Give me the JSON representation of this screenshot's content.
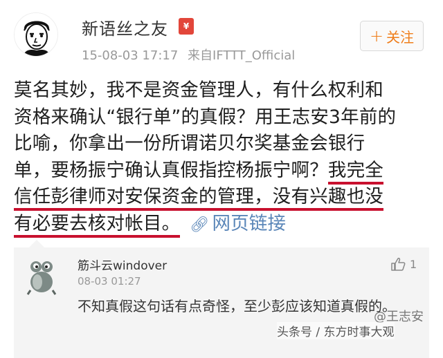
{
  "post": {
    "author": "新语丝之友",
    "badge_text": "¥",
    "timestamp": "15-08-03 17:17",
    "source": "来自IFTTT_Official",
    "follow_label": "关注",
    "text_line1": "莫名其妙，我不是资金管理人，有什么权利和",
    "text_line2": "资格来确认“银行单”的真假？用王志安3年前的",
    "text_line3": "比喻，你拿出一份所谓诺贝尔奖基金会银行",
    "text_line4_plain": "单，要杨振宁确认真假指控杨振宁啊？",
    "text_line4_hl": "我完全",
    "text_line5": "信任彭律师对安保资金的管理，没有兴趣也没",
    "text_line6": "有必要去核对帐目。",
    "link_text": "网页链接",
    "link_icon": "link-icon"
  },
  "comment": {
    "author": "筋斗云windover",
    "time": "08-03 01:27",
    "likes": "1",
    "text": "不知真假这句话有点奇怪，至少彭应该知道真假的。"
  },
  "watermark": {
    "logo_text": "@王志安",
    "caption": "头条号 / 东方时事大观"
  },
  "colors": {
    "underline": "#c8102e",
    "follow": "#ef7d1a",
    "link": "#5a86b8",
    "badge": "#e2463a"
  }
}
